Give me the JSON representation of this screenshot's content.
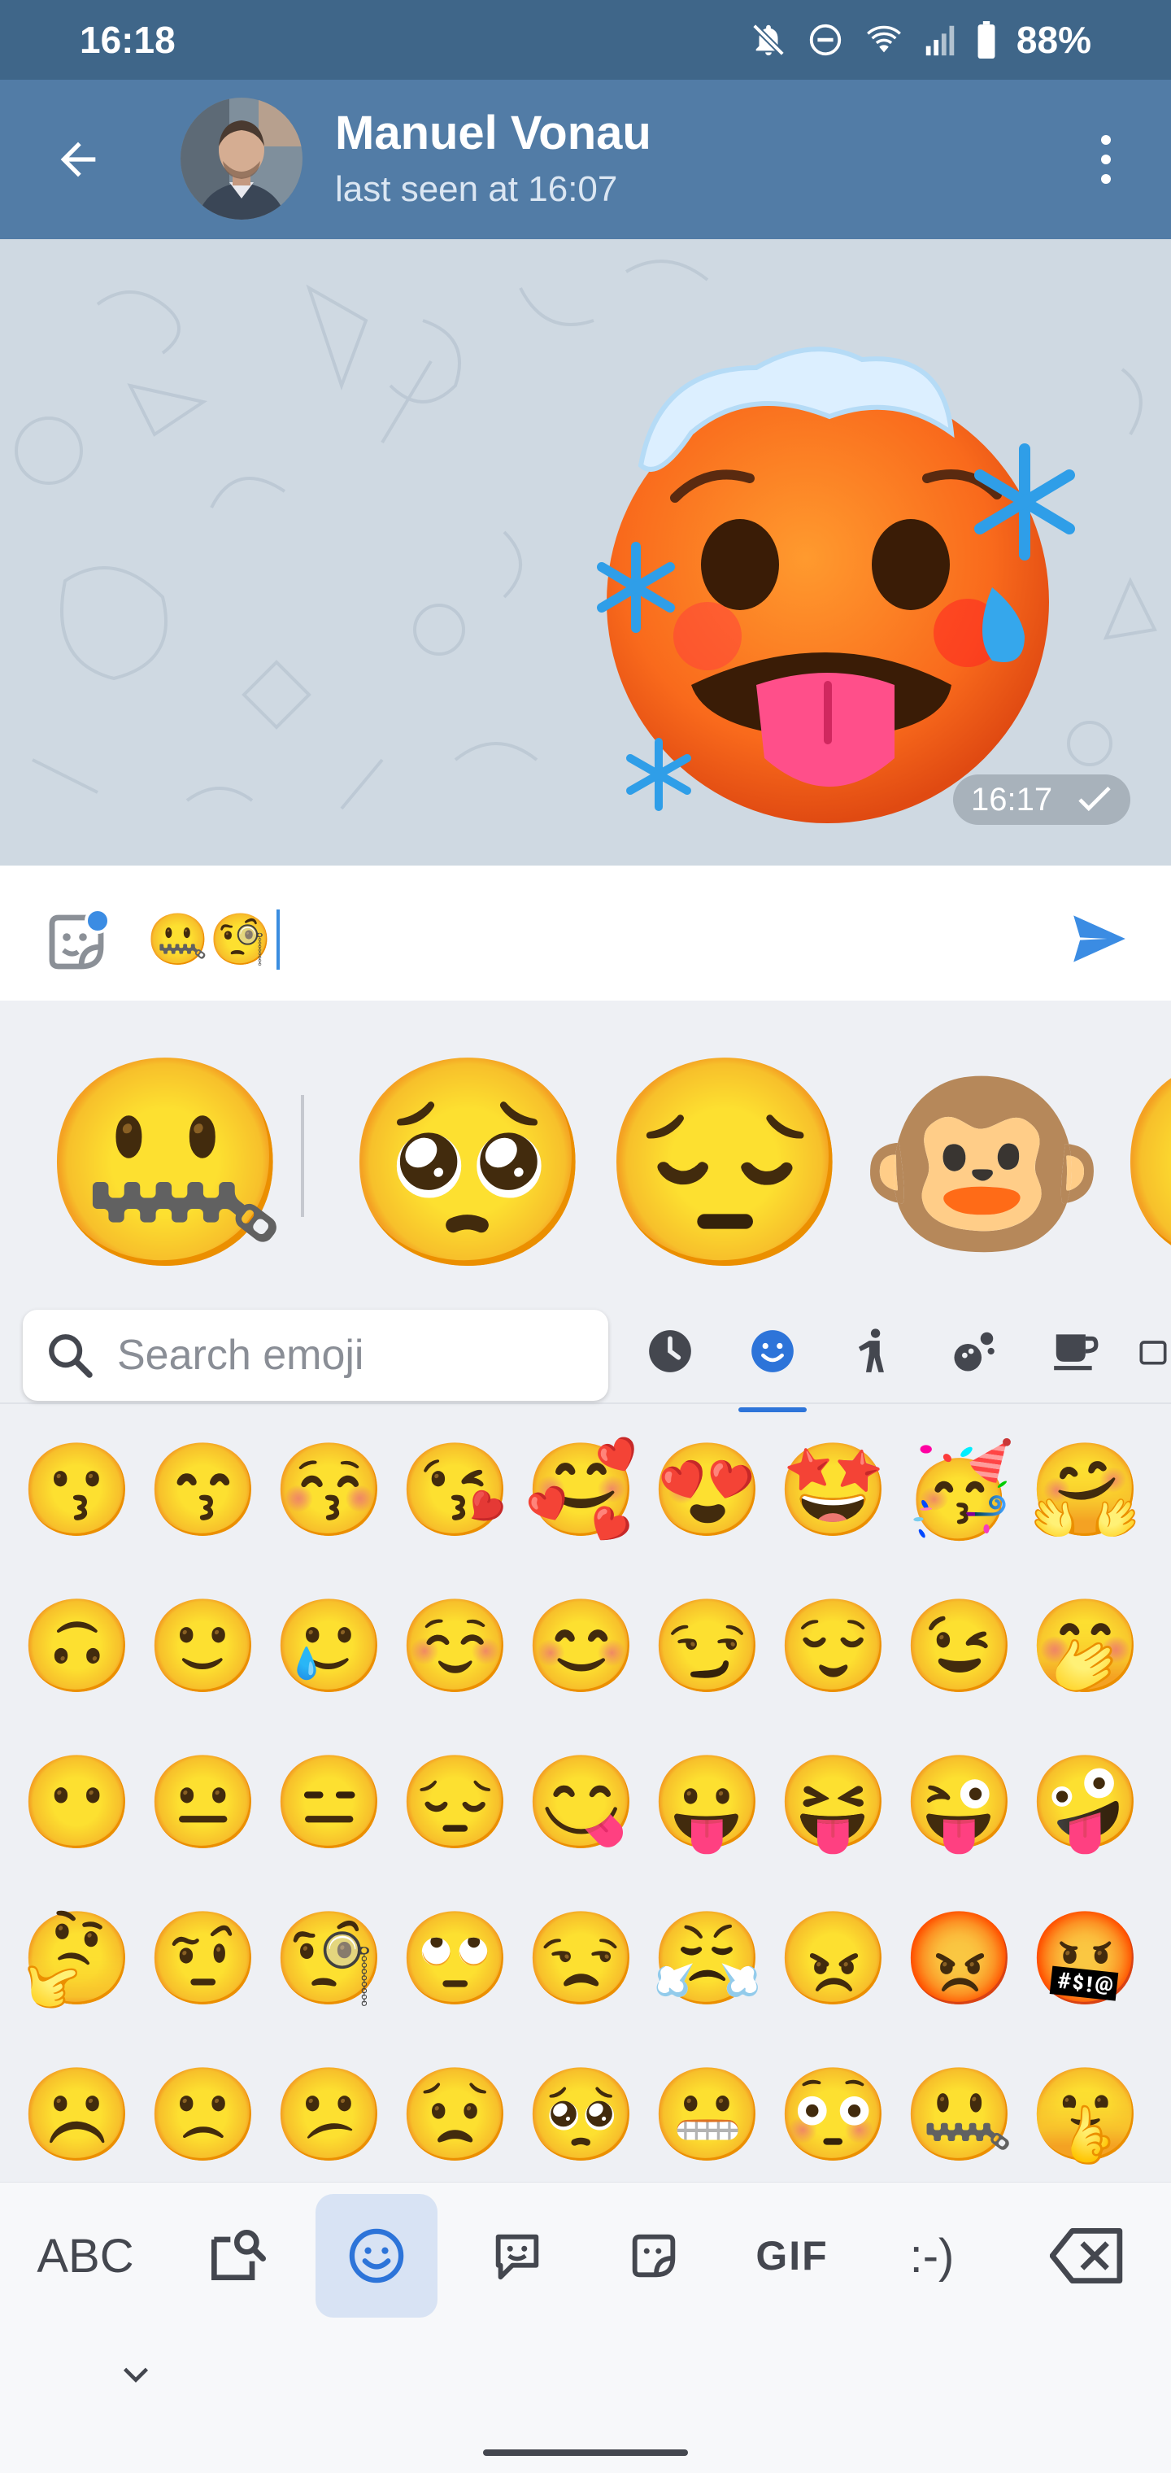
{
  "status_bar": {
    "time": "16:18",
    "battery": "88%",
    "icons": [
      "notifications-off-icon",
      "do-not-disturb-icon",
      "wifi-icon",
      "cellular-signal-icon",
      "battery-icon"
    ]
  },
  "app_bar": {
    "contact_name": "Manuel Vonau",
    "last_seen": "last seen at 16:07"
  },
  "message": {
    "sticker": "🥵🥶 cold-face sticker",
    "time": "16:17",
    "status": "sent"
  },
  "input": {
    "value": "🤐🧐",
    "sticker_badge_color": "#3b8ce3",
    "send_color": "#3b8ce3"
  },
  "suggestions": [
    "🤐",
    "🥺",
    "😔",
    "🐵",
    "😮"
  ],
  "search": {
    "placeholder": "Search emoji",
    "categories": [
      "recent-icon",
      "smileys-icon",
      "people-icon",
      "activities-icon",
      "food-drink-icon"
    ],
    "active_category": "smileys-icon",
    "accent": "#2d74d9"
  },
  "emoji_grid": [
    [
      "😗",
      "😙",
      "😚",
      "😘",
      "🥰",
      "😍",
      "🤩",
      "🥳",
      "🤗"
    ],
    [
      "🙃",
      "🙂",
      "🥲",
      "☺️",
      "😊",
      "😏",
      "😌",
      "😉",
      "🤭"
    ],
    [
      "😶",
      "😐",
      "😑",
      "😔",
      "😋",
      "😛",
      "😝",
      "😜",
      "🤪"
    ],
    [
      "🤔",
      "🤨",
      "🧐",
      "🙄",
      "😒",
      "😤",
      "😠",
      "😡",
      "🤬"
    ],
    [
      "☹️",
      "🙁",
      "😕",
      "😟",
      "🥺",
      "😬",
      "😳",
      "🤐",
      "🤫"
    ]
  ],
  "keyboard": {
    "abc": "ABC",
    "gif": "GIF",
    "emoticon": ":-)"
  }
}
